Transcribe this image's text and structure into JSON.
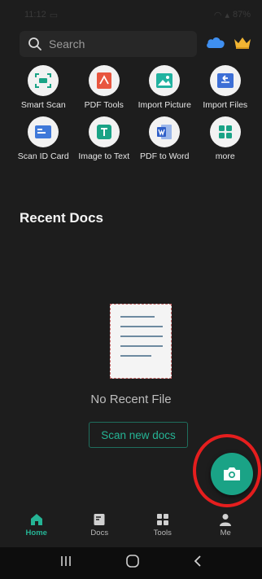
{
  "status_bar": {
    "time": "11:12",
    "battery": "87%"
  },
  "search": {
    "placeholder": "Search"
  },
  "tools": [
    {
      "label": "Smart Scan",
      "icon": "smart-scan-icon"
    },
    {
      "label": "PDF Tools",
      "icon": "pdf-icon"
    },
    {
      "label": "Import Picture",
      "icon": "image-icon"
    },
    {
      "label": "Import Files",
      "icon": "import-files-icon"
    },
    {
      "label": "Scan ID Card",
      "icon": "id-card-icon"
    },
    {
      "label": "Image to Text",
      "icon": "text-icon"
    },
    {
      "label": "PDF to Word",
      "icon": "word-icon"
    },
    {
      "label": "more",
      "icon": "more-icon"
    }
  ],
  "recent": {
    "title": "Recent Docs",
    "empty_text": "No Recent File",
    "scan_button": "Scan new docs"
  },
  "bottom_nav": [
    {
      "label": "Home",
      "active": true
    },
    {
      "label": "Docs",
      "active": false
    },
    {
      "label": "Tools",
      "active": false
    },
    {
      "label": "Me",
      "active": false
    }
  ],
  "colors": {
    "accent": "#25b495",
    "fab": "#1aa386",
    "highlight": "#e51e1e",
    "background": "#1d1d1d"
  }
}
